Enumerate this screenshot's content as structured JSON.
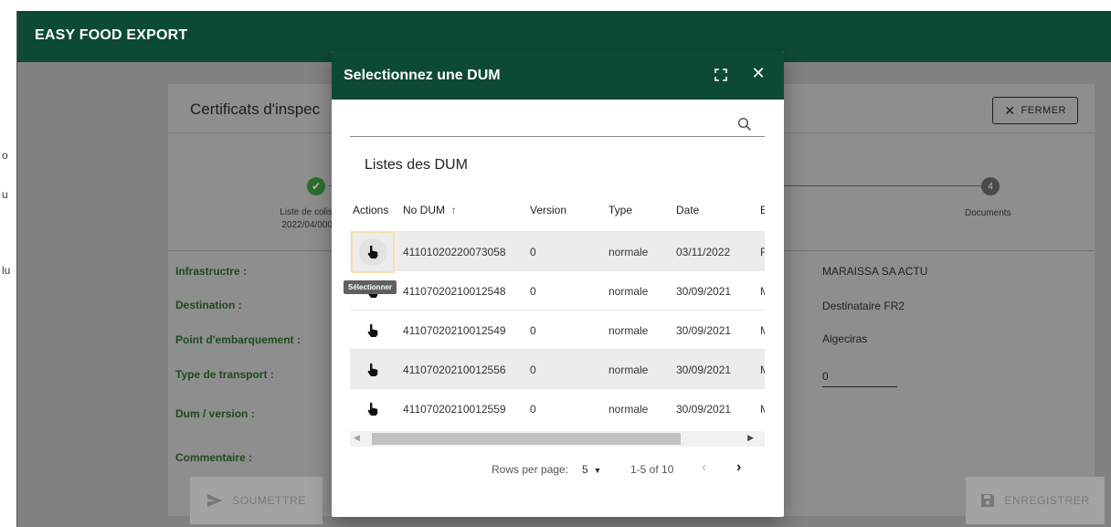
{
  "app": {
    "title": "EASY FOOD EXPORT"
  },
  "edge_letters": [
    "o",
    "u",
    "lu"
  ],
  "card": {
    "title": "Certificats d'inspec",
    "close_label": "FERMER"
  },
  "stepper": {
    "step1_label_line1": "Liste de colis",
    "step1_label_line2": "2022/04/000",
    "step4_number": "4",
    "step4_label": "Documents"
  },
  "form": {
    "labels": {
      "infrastructure": "Infrastructre :",
      "destination": "Destination :",
      "point_embarquement": "Point d'embarquement :",
      "type_transport": "Type de transport :",
      "dum_version": "Dum / version :",
      "commentaire": "Commentaire :"
    },
    "values": {
      "infrastructure": "MARAISSA SA ACTU",
      "destination": "Destinataire FR2",
      "point_embarquement": "Algeciras",
      "type_transport": "0"
    }
  },
  "buttons": {
    "submit": "SOUMETTRE",
    "save": "ENREGISTRER"
  },
  "dialog": {
    "title": "Selectionnez une DUM",
    "search_placeholder": "",
    "list_title": "Listes des DUM",
    "columns": {
      "actions": "Actions",
      "no_dum": "No DUM",
      "version": "Version",
      "type": "Type",
      "date": "Date",
      "extra": "E"
    },
    "rows": [
      {
        "no_dum": "41101020220073058",
        "version": "0",
        "type": "normale",
        "date": "03/11/2022",
        "extra": "F"
      },
      {
        "no_dum": "41107020210012548",
        "version": "0",
        "type": "normale",
        "date": "30/09/2021",
        "extra": "M"
      },
      {
        "no_dum": "41107020210012549",
        "version": "0",
        "type": "normale",
        "date": "30/09/2021",
        "extra": "M"
      },
      {
        "no_dum": "41107020210012556",
        "version": "0",
        "type": "normale",
        "date": "30/09/2021",
        "extra": "M"
      },
      {
        "no_dum": "41107020210012559",
        "version": "0",
        "type": "normale",
        "date": "30/09/2021",
        "extra": "M"
      }
    ],
    "tooltip": "Sélectionner",
    "pagination": {
      "rows_per_page_label": "Rows per page:",
      "rows_per_page_value": "5",
      "range": "1-5 of 10"
    }
  },
  "colors": {
    "brand_green": "#0d4a36",
    "step_done": "#2d6d2c",
    "label_green": "#1f4a1f"
  },
  "icons": {
    "fullscreen": "fullscreen-icon",
    "close": "close-icon",
    "search": "search-icon",
    "select": "pointing-hand-icon",
    "sort": "arrow-up-icon",
    "send": "send-icon",
    "save": "floppy-disk-icon"
  }
}
